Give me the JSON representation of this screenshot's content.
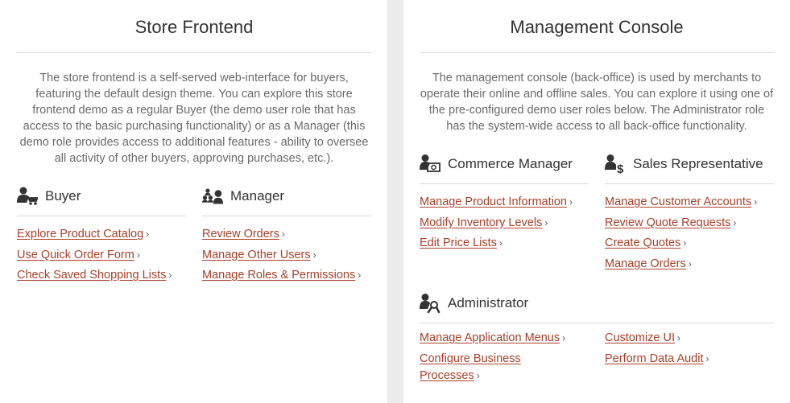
{
  "store": {
    "title": "Store Frontend",
    "description": "The store frontend is a self-served web-interface for buyers, featuring the default design theme. You can explore this store frontend demo as a regular Buyer (the demo user role that has access to the basic purchasing functionality) or as a Manager (this demo role provides access to additional features - ability to oversee all activity of other buyers, approving purchases, etc.).",
    "buyer": {
      "name": "Buyer",
      "icon": "buyer-cart-icon",
      "links": [
        "Explore Product Catalog",
        "Use Quick Order Form",
        "Check Saved Shopping Lists"
      ]
    },
    "manager": {
      "name": "Manager",
      "icon": "manager-team-icon",
      "links": [
        "Review Orders",
        "Manage Other Users",
        "Manage Roles & Permissions"
      ]
    }
  },
  "console": {
    "title": "Management Console",
    "description": "The management console (back-office) is used by merchants to operate their online and offline sales. You can explore it using one of the pre-configured demo user roles below. The Administrator role has the system-wide access to all back-office functionality.",
    "commerce_manager": {
      "name": "Commerce Manager",
      "icon": "commerce-manager-money-icon",
      "links": [
        "Manage Product Information",
        "Modify Inventory Levels",
        "Edit Price Lists"
      ]
    },
    "sales_rep": {
      "name": "Sales Representative",
      "icon": "sales-dollar-icon",
      "links": [
        "Manage Customer Accounts",
        "Review Quote Requests",
        "Create Quotes",
        "Manage Orders"
      ]
    },
    "administrator": {
      "name": "Administrator",
      "icon": "administrator-wrench-icon",
      "links_col1": [
        "Manage Application Menus",
        "Configure Business Processes"
      ],
      "links_col2": [
        "Customize UI",
        "Perform Data Audit"
      ]
    }
  },
  "chevron": "›",
  "colors": {
    "link": "#a8402a",
    "divider": "#ebebeb",
    "rule": "#d9d9d9"
  }
}
